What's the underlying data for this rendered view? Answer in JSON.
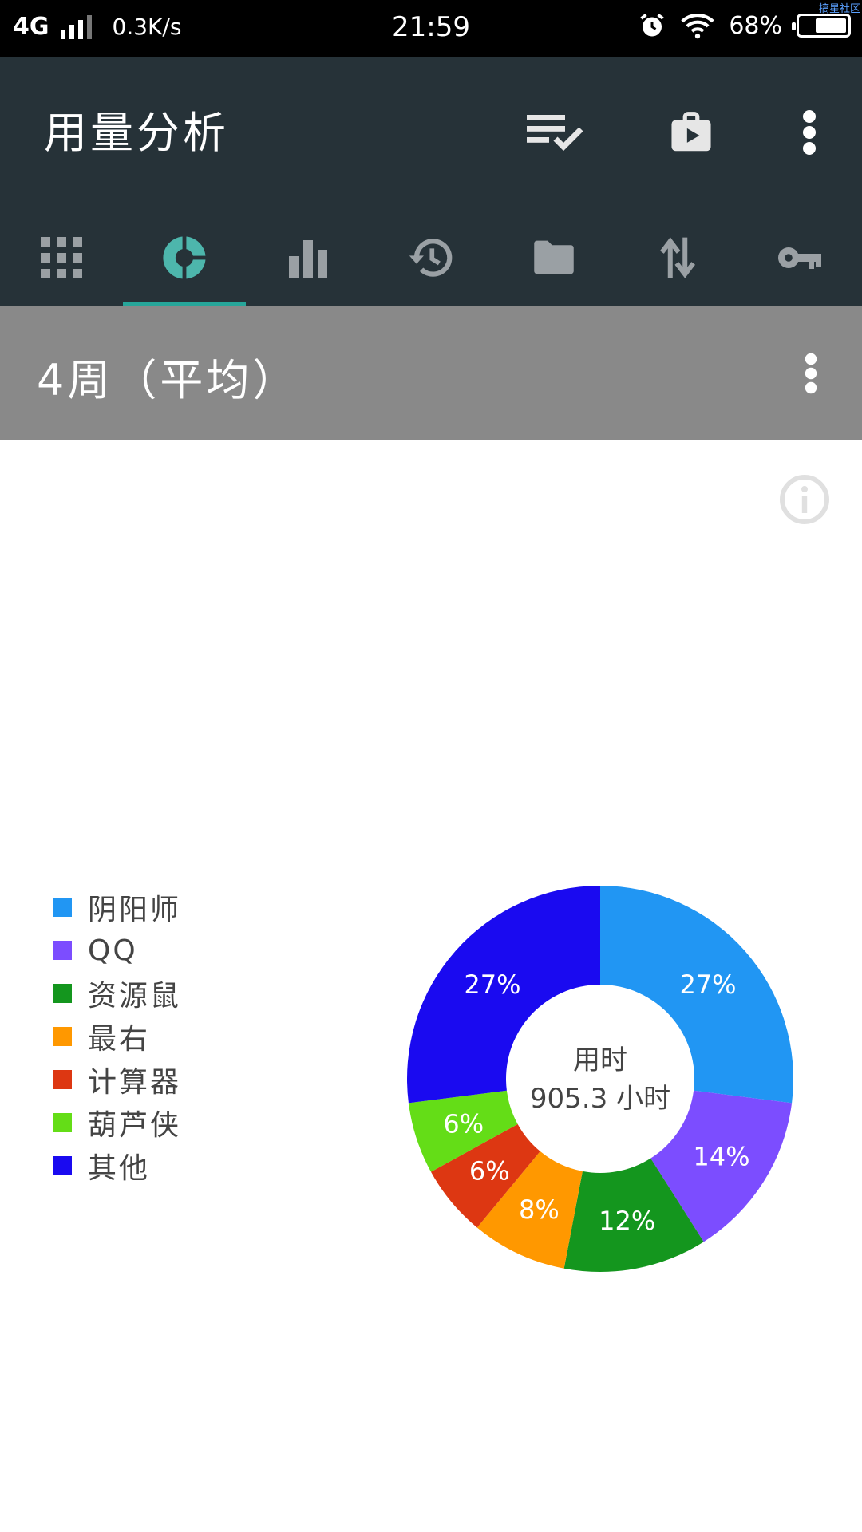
{
  "status_bar": {
    "network": "4G",
    "speed": "0.3K/s",
    "time": "21:59",
    "battery": "68%",
    "battery_level": 0.68,
    "watermark": "搞星社区"
  },
  "app_bar": {
    "title": "用量分析",
    "actions": [
      "checklist-icon",
      "play-store-icon",
      "more-vert-icon"
    ]
  },
  "tabs": [
    {
      "icon": "apps-grid-icon",
      "selected": false
    },
    {
      "icon": "pie-chart-icon",
      "selected": true
    },
    {
      "icon": "bar-chart-icon",
      "selected": false
    },
    {
      "icon": "history-icon",
      "selected": false
    },
    {
      "icon": "folder-icon",
      "selected": false
    },
    {
      "icon": "swap-vertical-icon",
      "selected": false
    },
    {
      "icon": "key-icon",
      "selected": false
    }
  ],
  "period": {
    "label": "4周（平均）"
  },
  "colors": {
    "appbar": "#263238",
    "accent": "#26a69a",
    "subbar": "#898989"
  },
  "chart_data": {
    "type": "pie",
    "donut": true,
    "center_title": "用时",
    "center_value": "905.3 小时",
    "slices": [
      {
        "label": "阴阳师",
        "value": 27,
        "text": "27%",
        "color": "#2196f3"
      },
      {
        "label": "QQ",
        "value": 14,
        "text": "14%",
        "color": "#7c4dff"
      },
      {
        "label": "资源鼠",
        "value": 12,
        "text": "12%",
        "color": "#14961e"
      },
      {
        "label": "最右",
        "value": 8,
        "text": "8%",
        "color": "#ff9800"
      },
      {
        "label": "计算器",
        "value": 6,
        "text": "6%",
        "color": "#dd3712"
      },
      {
        "label": "葫芦侠",
        "value": 6,
        "text": "6%",
        "color": "#64dd17"
      },
      {
        "label": "其他",
        "value": 27,
        "text": "27%",
        "color": "#1a0af0"
      }
    ],
    "legend_position": "left"
  }
}
